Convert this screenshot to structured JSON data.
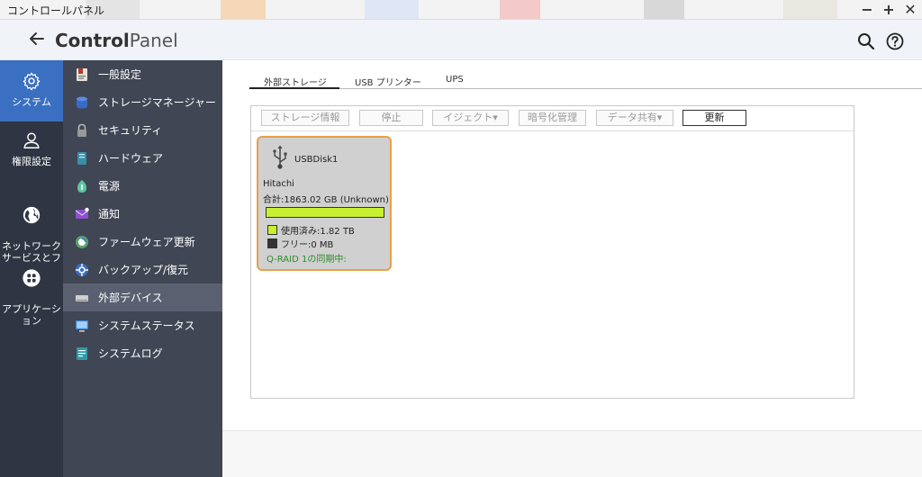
{
  "window": {
    "title": "コントロールパネル",
    "buttons": [
      "−",
      "+",
      "✕"
    ]
  },
  "header": {
    "app_title_bold": "Control",
    "app_title_light": "Panel",
    "icons": [
      "back-arrow-icon",
      "search-icon",
      "help-icon"
    ]
  },
  "primary_nav": [
    {
      "label": "システム",
      "icon": "gear-icon",
      "active": true
    },
    {
      "label": "権限設定",
      "icon": "user-icon",
      "active": false
    },
    {
      "label": "ネットワーク\nサービスとフ",
      "icon": "globe-icon",
      "active": false
    },
    {
      "label": "アプリケーシ\nョン",
      "icon": "apps-icon",
      "active": false
    }
  ],
  "secondary_nav": [
    {
      "label": "一般設定",
      "icon": "general-settings-icon",
      "active": false
    },
    {
      "label": "ストレージマネージャー",
      "icon": "storage-icon",
      "active": false
    },
    {
      "label": "セキュリティ",
      "icon": "lock-icon",
      "active": false
    },
    {
      "label": "ハードウェア",
      "icon": "hardware-icon",
      "active": false
    },
    {
      "label": "電源",
      "icon": "power-icon",
      "active": false
    },
    {
      "label": "通知",
      "icon": "notification-icon",
      "active": false
    },
    {
      "label": "ファームウェア更新",
      "icon": "firmware-icon",
      "active": false
    },
    {
      "label": "バックアップ/復元",
      "icon": "backup-icon",
      "active": false
    },
    {
      "label": "外部デバイス",
      "icon": "external-device-icon",
      "active": true
    },
    {
      "label": "システムステータス",
      "icon": "monitor-icon",
      "active": false
    },
    {
      "label": "システムログ",
      "icon": "log-icon",
      "active": false
    }
  ],
  "tabs": [
    {
      "label": "外部ストレージ",
      "active": true
    },
    {
      "label": "USB プリンター",
      "active": false
    },
    {
      "label": "UPS",
      "active": false
    }
  ],
  "toolbar": {
    "storage_info": "ストレージ情報",
    "stop": "停止",
    "eject": "イジェクト▾",
    "encryption": "暗号化管理",
    "data_share": "データ共有▾",
    "refresh": "更新"
  },
  "disk": {
    "name": "USBDisk1",
    "vendor": "Hitachi",
    "total": "合計:1863.02 GB (Unknown)",
    "used_label": "使用済み:1.82 TB",
    "free_label": "フリー:0 MB",
    "used_fraction": 1.0,
    "sync_status": "Q-RAID 1の同期中:",
    "colors": {
      "used": "#c8f031",
      "free": "#333333",
      "border": "#e8a04a",
      "sync_text": "#2e8b2e"
    }
  }
}
